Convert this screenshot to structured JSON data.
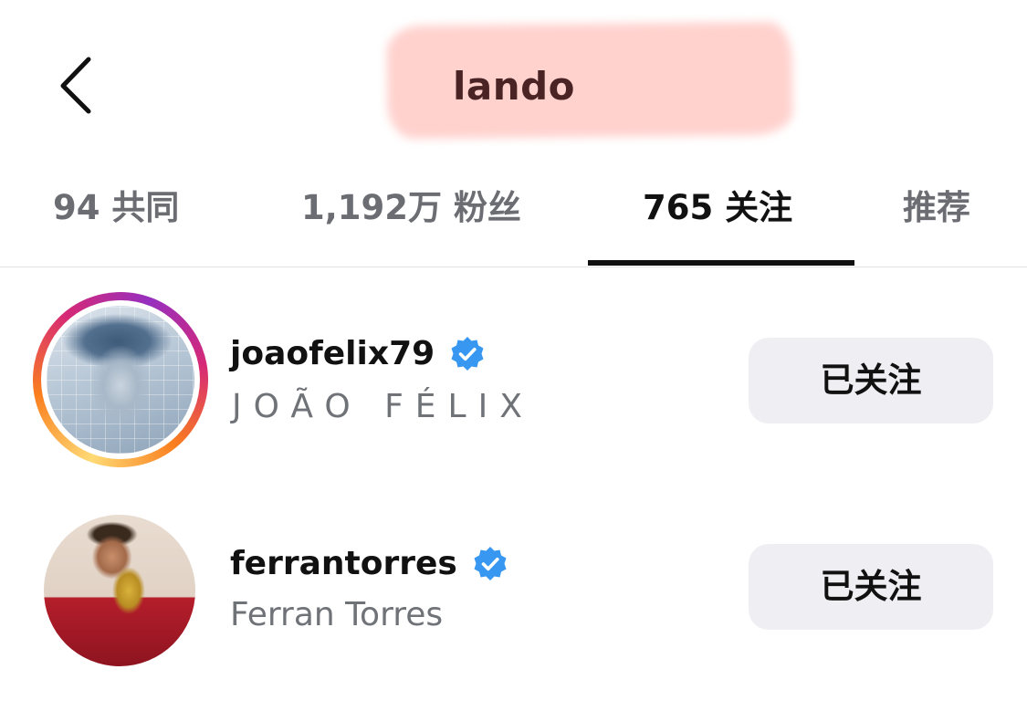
{
  "header": {
    "back_icon": "chevron-left-icon",
    "title": "lando",
    "title_highlight_color": "#ffd2ce"
  },
  "tabs": [
    {
      "label": "94 共同",
      "active": false
    },
    {
      "label": "1,192万 粉丝",
      "active": false
    },
    {
      "label": "765 关注",
      "active": true
    },
    {
      "label": "推荐",
      "active": false
    }
  ],
  "users": [
    {
      "username": "joaofelix79",
      "full_name": "JOÃO FÉLIX",
      "verified": true,
      "has_story": true,
      "follow_button_label": "已关注",
      "avatar_icon": "avatar-image"
    },
    {
      "username": "ferrantorres",
      "full_name": "Ferran Torres",
      "verified": true,
      "has_story": false,
      "follow_button_label": "已关注",
      "avatar_icon": "avatar-image"
    }
  ],
  "colors": {
    "verified_blue": "#3897f0",
    "button_bg": "#efeff3",
    "secondary_text": "#6f7277",
    "active_tab_indicator": "#111111"
  }
}
